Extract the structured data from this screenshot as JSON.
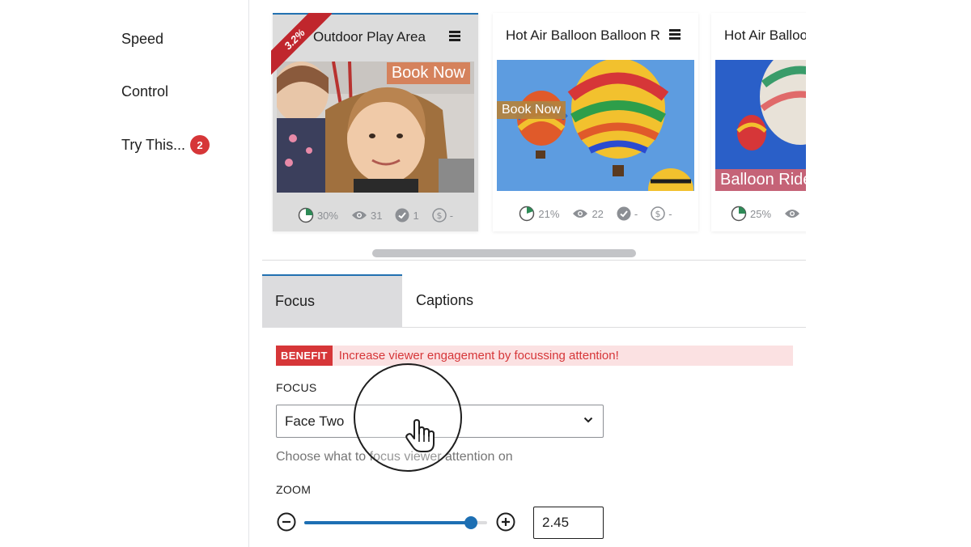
{
  "sidebar": {
    "items": [
      {
        "label": "Speed"
      },
      {
        "label": "Control"
      },
      {
        "label": "Try This...",
        "badge": "2"
      }
    ]
  },
  "cards": [
    {
      "title": "Outdoor Play Area",
      "ribbon": "3.2%",
      "overlay": "Book Now",
      "stats": {
        "progress": "30%",
        "views": "31",
        "checks": "1",
        "money": "-"
      }
    },
    {
      "title": "Hot Air Balloon Balloon Rides",
      "overlay": "Book Now",
      "stats": {
        "progress": "21%",
        "views": "22",
        "checks": "-",
        "money": "-"
      }
    },
    {
      "title": "Hot Air Balloon",
      "overlay": "Balloon Rides",
      "stats": {
        "progress": "25%"
      }
    }
  ],
  "tabs": [
    {
      "label": "Focus"
    },
    {
      "label": "Captions"
    }
  ],
  "benefit": {
    "tag": "BENEFIT",
    "text": "Increase viewer engagement by focussing attention!"
  },
  "focus": {
    "label": "FOCUS",
    "selected": "Face Two",
    "help": "Choose what to focus viewer attention on"
  },
  "zoom": {
    "label": "ZOOM",
    "value": "2.45",
    "slider_fraction": 0.91
  },
  "colors": {
    "accent": "#2271b1",
    "slider": "#1d6fb3",
    "danger": "#d63638",
    "benefit_bg": "#fbe1e2"
  },
  "icons": [
    "menu-icon",
    "pie-icon",
    "eye-icon",
    "check-icon",
    "dollar-icon",
    "minus-icon",
    "plus-icon",
    "chevron-down-icon",
    "hand-cursor-icon"
  ]
}
